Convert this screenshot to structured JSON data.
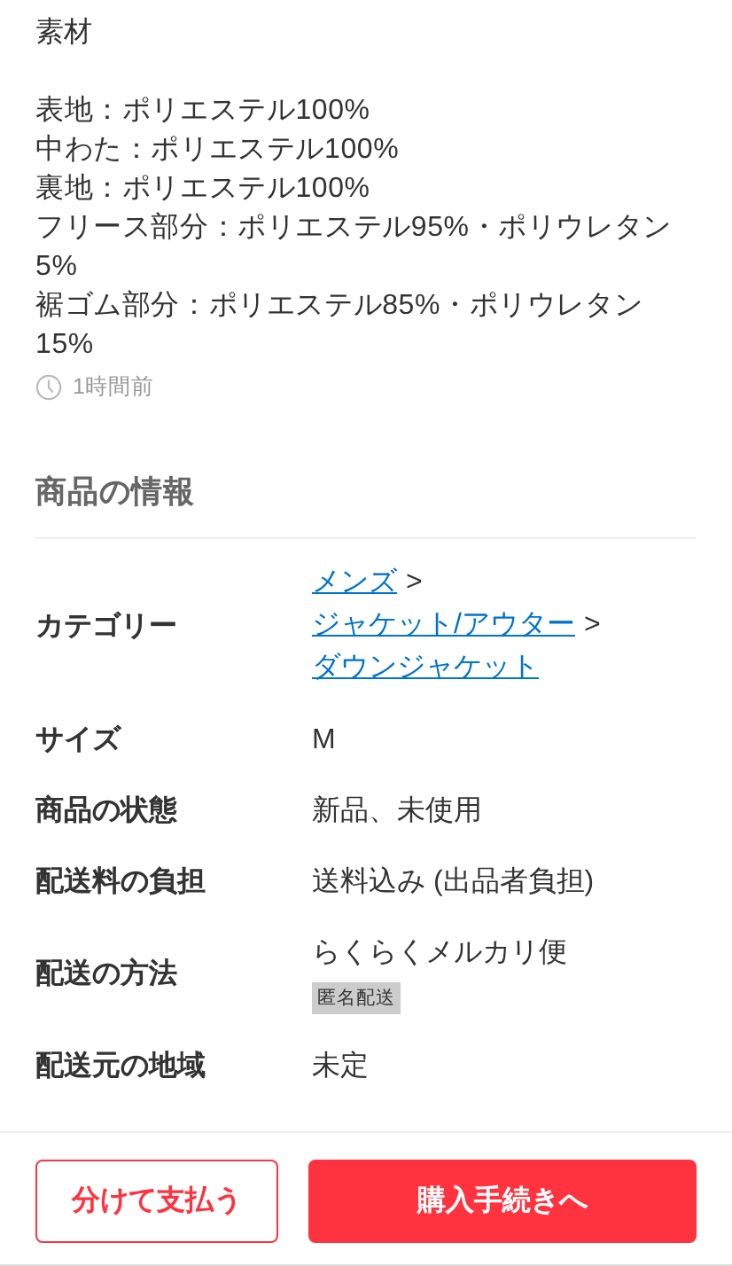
{
  "description": {
    "title": "素材",
    "lines": [
      "表地：ポリエステル100%",
      "中わた：ポリエステル100%",
      "裏地：ポリエステル100%",
      "フリース部分：ポリエステル95%・ポリウレタン5%",
      "裾ゴム部分：ポリエステル85%・ポリウレタン15%"
    ],
    "posted": "1時間前"
  },
  "info": {
    "heading": "商品の情報",
    "rows": [
      {
        "kind": "path",
        "label": "カテゴリー",
        "path": [
          {
            "label": "メンズ",
            "separator": ">"
          },
          {
            "label": "ジャケット/アウター",
            "separator": ">"
          },
          {
            "label": "ダウンジャケット"
          }
        ]
      },
      {
        "kind": "text",
        "label": "サイズ",
        "value": "M"
      },
      {
        "kind": "text",
        "label": "商品の状態",
        "value": "新品、未使用"
      },
      {
        "kind": "text",
        "label": "配送料の負担",
        "value": "送料込み (出品者負担)"
      },
      {
        "kind": "tagged",
        "label": "配送の方法",
        "value": "らくらくメルカリ便",
        "tag": "匿名配送"
      },
      {
        "kind": "text",
        "label": "配送元の地域",
        "value": "未定"
      }
    ]
  },
  "footer": {
    "buttons": [
      {
        "label": "分けて支払う",
        "kind": "outline"
      },
      {
        "label": "購入手続きへ",
        "kind": "primary"
      }
    ]
  }
}
